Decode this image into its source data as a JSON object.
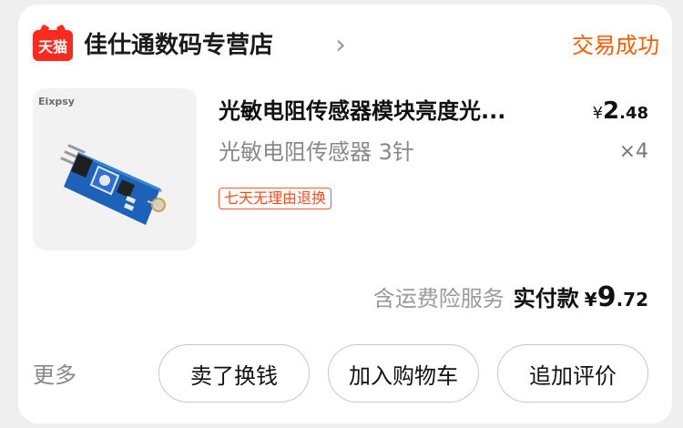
{
  "shop": {
    "logo_text": "天猫",
    "name": "佳仕通数码专营店",
    "arrow": "›",
    "status": "交易成功"
  },
  "product": {
    "image_brand": "Eixpsy",
    "title": "光敏电阻传感器模块亮度光...",
    "spec": "光敏电阻传感器 3针",
    "price_yen": "¥",
    "price_int": "2",
    "price_dec": ".48",
    "quantity": "×4",
    "tag": "七天无理由退换"
  },
  "total": {
    "note": "含运费险服务",
    "label": "实付款",
    "yen": "¥",
    "int": "9",
    "dec": ".72"
  },
  "actions": {
    "more": "更多",
    "buttons": [
      "卖了换钱",
      "加入购物车",
      "追加评价"
    ]
  },
  "colors": {
    "accent": "#ff5a00",
    "tmall_red": "#ff2a1f"
  }
}
